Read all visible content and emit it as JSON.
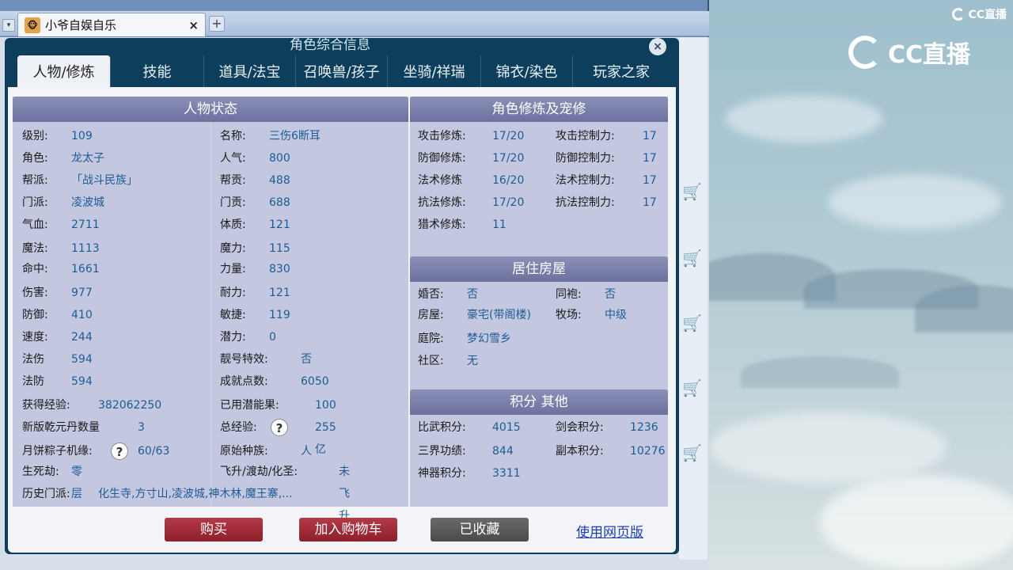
{
  "browser": {
    "tab_title": "小爷自娱自乐",
    "tab_close": "×",
    "new_tab": "+",
    "tab_menu": "▾"
  },
  "watermark": {
    "small": "CC直播",
    "big": "CC直播"
  },
  "dialog": {
    "title": "角色综合信息",
    "close": "×",
    "tabs": [
      "人物/修炼",
      "技能",
      "道具/法宝",
      "召唤兽/孩子",
      "坐骑/祥瑞",
      "锦衣/染色",
      "玩家之家"
    ],
    "active_tab": 0
  },
  "status": {
    "header": "人物状态",
    "left": [
      {
        "label": "级别:",
        "value": "109"
      },
      {
        "label": "角色:",
        "value": "龙太子"
      },
      {
        "label": "帮派:",
        "value": "「战斗民族」"
      },
      {
        "label": "门派:",
        "value": "凌波城"
      },
      {
        "label": "气血:",
        "value": "2711"
      },
      {
        "label": "魔法:",
        "value": "1113"
      },
      {
        "label": "命中:",
        "value": "1661"
      },
      {
        "label": "伤害:",
        "value": "977"
      },
      {
        "label": "防御:",
        "value": "410"
      },
      {
        "label": "速度:",
        "value": "244"
      },
      {
        "label": "法伤",
        "value": "594"
      },
      {
        "label": "法防",
        "value": "594"
      }
    ],
    "right": [
      {
        "label": "名称:",
        "value": "三伤6断耳"
      },
      {
        "label": "人气:",
        "value": "800"
      },
      {
        "label": "帮贡:",
        "value": "488"
      },
      {
        "label": "门贡:",
        "value": "688"
      },
      {
        "label": "体质:",
        "value": "121"
      },
      {
        "label": "魔力:",
        "value": "115"
      },
      {
        "label": "力量:",
        "value": "830"
      },
      {
        "label": "耐力:",
        "value": "121"
      },
      {
        "label": "敏捷:",
        "value": "119"
      },
      {
        "label": "潜力:",
        "value": "0"
      },
      {
        "label": "靓号特效:",
        "value": "否"
      },
      {
        "label": "成就点数:",
        "value": "6050"
      }
    ],
    "extra": {
      "exp_label": "获得经验:",
      "exp_value": "382062250",
      "used_label": "已用潜能果:",
      "used_value": "100",
      "qy_label": "新版乾元丹数量",
      "qy_value": "3",
      "total_label": "总经验:",
      "total_value": "255亿",
      "moon_label": "月饼粽子机缘:",
      "moon_value": "60/63",
      "race_label": "原始种族:",
      "race_value": "人",
      "life_label": "生死劫:",
      "life_value": "零层",
      "fly_label": "飞升/渡劫/化圣:",
      "fly_value": "未飞升",
      "hist_label": "历史门派:",
      "hist_value": "化生寺,方寸山,凌波城,神木林,魔王寨,..."
    }
  },
  "cultivation": {
    "header": "角色修炼及宠修",
    "rows": [
      {
        "label": "攻击修炼:",
        "value": "17/20",
        "label2": "攻击控制力:",
        "value2": "17"
      },
      {
        "label": "防御修炼:",
        "value": "17/20",
        "label2": "防御控制力:",
        "value2": "17"
      },
      {
        "label": "法术修炼",
        "value": "16/20",
        "label2": "法术控制力:",
        "value2": "17"
      },
      {
        "label": "抗法修炼:",
        "value": "17/20",
        "label2": "抗法控制力:",
        "value2": "17"
      },
      {
        "label": "猎术修炼:",
        "value": "11",
        "label2": "",
        "value2": ""
      }
    ]
  },
  "house": {
    "header": "居住房屋",
    "rows": [
      {
        "label": "婚否:",
        "value": "否",
        "label2": "同袍:",
        "value2": "否"
      },
      {
        "label": "房屋:",
        "value": "豪宅(带阁楼)",
        "label2": "牧场:",
        "value2": "中级"
      },
      {
        "label": "庭院:",
        "value": "梦幻雪乡",
        "label2": "",
        "value2": ""
      },
      {
        "label": "社区:",
        "value": "无",
        "label2": "",
        "value2": ""
      }
    ]
  },
  "points": {
    "header": "积分 其他",
    "rows": [
      {
        "label": "比武积分:",
        "value": "4015",
        "label2": "剑会积分:",
        "value2": "1236"
      },
      {
        "label": "三界功绩:",
        "value": "844",
        "label2": "副本积分:",
        "value2": "10276"
      },
      {
        "label": "神器积分:",
        "value": "3311",
        "label2": "",
        "value2": ""
      }
    ]
  },
  "buttons": {
    "buy": "购买",
    "cart": "加入购物车",
    "fav": "已收藏",
    "web": "使用网页版"
  }
}
